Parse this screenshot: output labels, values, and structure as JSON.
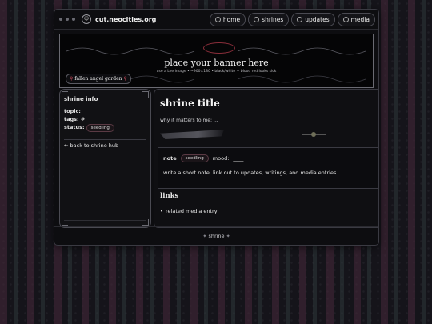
{
  "window": {
    "site_icon": "☺",
    "site_name": "cut.neocities.org"
  },
  "nav": {
    "items": [
      {
        "label": "home",
        "icon": "smiley-icon"
      },
      {
        "label": "shrines",
        "icon": "smiley-icon"
      },
      {
        "label": "updates",
        "icon": "smiley-icon"
      },
      {
        "label": "media",
        "icon": "smiley-icon"
      }
    ]
  },
  "banner": {
    "title": "place your banner here",
    "subtitle": "use a Lee image • ~900×180 • black/white + blood red looks sick",
    "tag": "fallen angel garden"
  },
  "sidebar": {
    "heading": "shrine info",
    "topic_label": "topic:",
    "topic_value": "_____",
    "tags_label": "tags:",
    "tags_value": "#____",
    "status_label": "status:",
    "status_value": "seedling",
    "back_link": "← back to shrine hub"
  },
  "main": {
    "title": "shrine title",
    "subtitle": "why it matters to me: ...",
    "note": {
      "label": "note",
      "status": "seedling",
      "mood_label": "mood:",
      "mood_value": "____",
      "text": "write a short note. link out to updates, writings, and media entries."
    },
    "links_heading": "links",
    "links": [
      "related media entry"
    ]
  },
  "footer": {
    "text": "shrine"
  },
  "colors": {
    "accent_red": "#c84a5a",
    "background": "#0d0d10"
  }
}
